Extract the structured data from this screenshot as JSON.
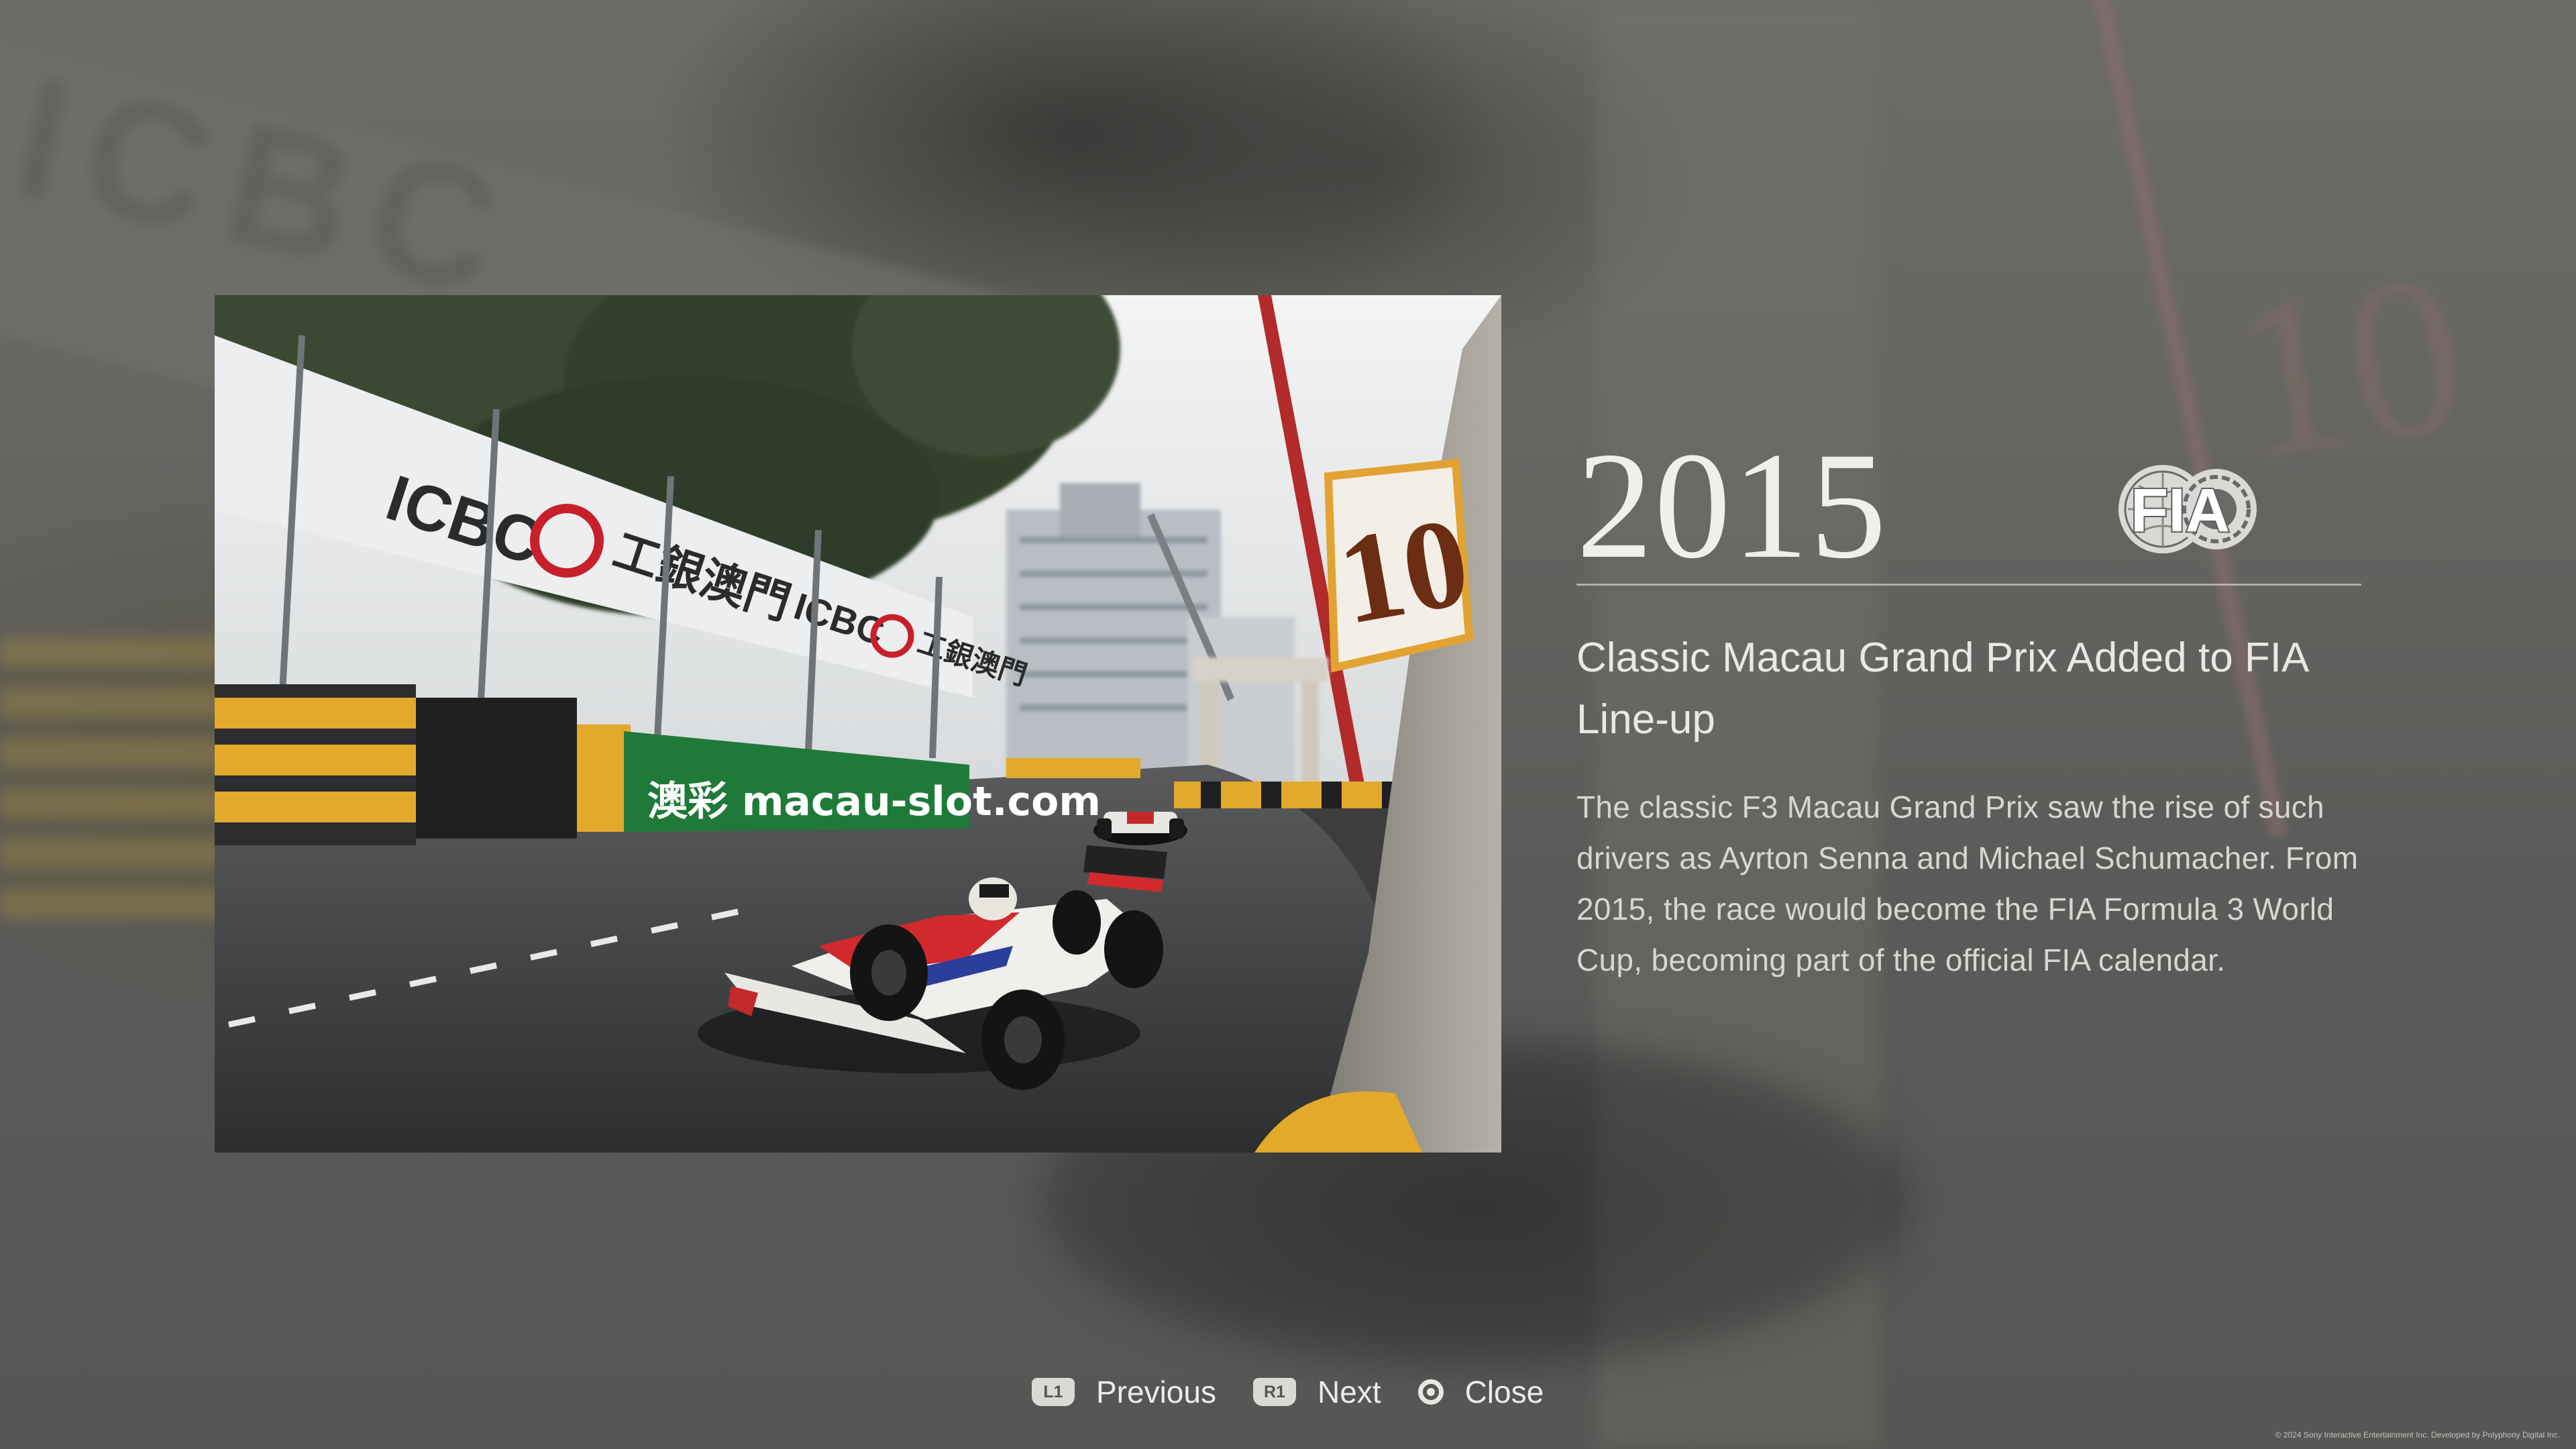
{
  "entry": {
    "year": "2015",
    "logo": "FIA",
    "headline": "Classic Macau Grand Prix Added to FIA Line-up",
    "body": "The classic F3 Macau Grand Prix saw the rise of such drivers as Ayrton Senna and Michael Schumacher. From 2015, the race would become the FIA Formula 3 World Cup, becoming part of the official FIA calendar."
  },
  "photo": {
    "signage": {
      "banner_text_1": "ICBC",
      "banner_text_2": "工銀澳門",
      "banner_text_3": "ICBC",
      "banner_text_4": "工銀澳門",
      "green_sign": "澳彩 macau-slot.com",
      "marker_number": "10"
    }
  },
  "navigation": {
    "previous": {
      "button": "L1",
      "label": "Previous"
    },
    "next": {
      "button": "R1",
      "label": "Next"
    },
    "close": {
      "label": "Close"
    }
  },
  "footer": {
    "copyright": "© 2024 Sony Interactive Entertainment Inc. Developed by Polyphony Digital Inc."
  },
  "colors": {
    "overlay": "#5f5f5c",
    "text_primary": "#efefec",
    "text_secondary": "#d6d6d2",
    "kerb_yellow": "#e3a92a",
    "banner_red": "#c8202a",
    "sign_green": "#1f7a3a"
  }
}
